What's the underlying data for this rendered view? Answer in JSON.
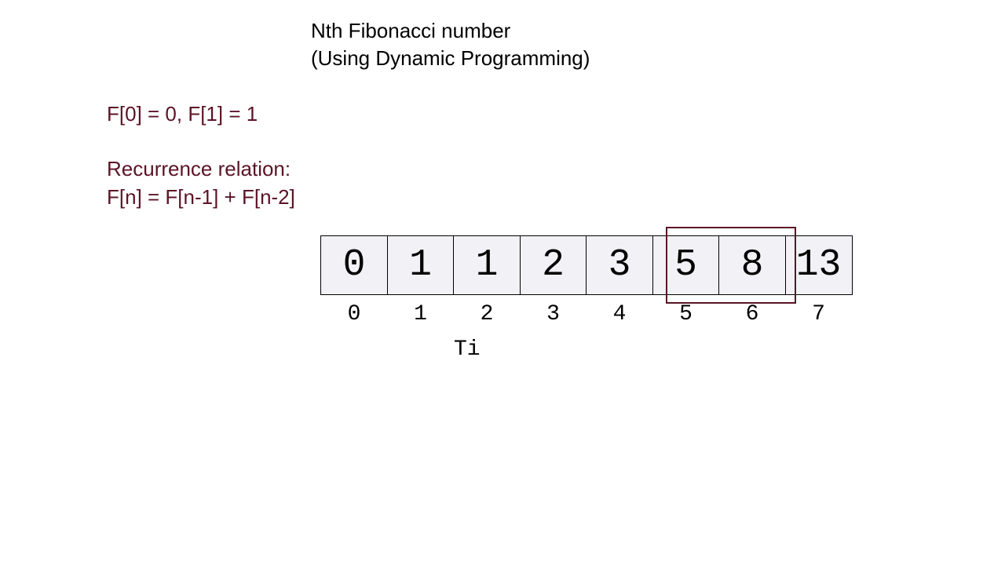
{
  "title_line1": "Nth Fibonacci number",
  "title_line2": "(Using Dynamic Programming)",
  "base_cases": "F[0] = 0, F[1] = 1",
  "recurrence_label": "Recurrence relation:",
  "recurrence_formula": "F[n] = F[n-1] + F[n-2]",
  "array_values": [
    "0",
    "1",
    "1",
    "2",
    "3",
    "5",
    "8",
    "13"
  ],
  "indices": [
    "0",
    "1",
    "2",
    "3",
    "4",
    "5",
    "6",
    "7"
  ],
  "caption": "Ti",
  "highlighted_indices": [
    5,
    6
  ],
  "chart_data": {
    "type": "table",
    "title": "Fibonacci DP array",
    "categories": [
      0,
      1,
      2,
      3,
      4,
      5,
      6,
      7
    ],
    "values": [
      0,
      1,
      1,
      2,
      3,
      5,
      8,
      13
    ],
    "highlight_range": [
      5,
      6
    ]
  }
}
